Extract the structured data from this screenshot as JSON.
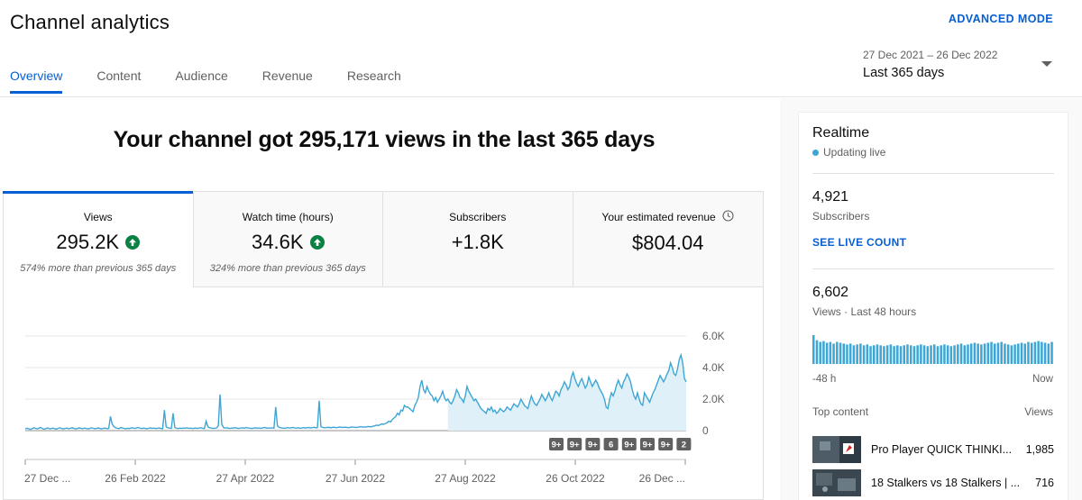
{
  "header": {
    "title": "Channel analytics",
    "advanced_mode": "ADVANCED MODE",
    "tabs": [
      {
        "label": "Overview",
        "active": true
      },
      {
        "label": "Content",
        "active": false
      },
      {
        "label": "Audience",
        "active": false
      },
      {
        "label": "Revenue",
        "active": false
      },
      {
        "label": "Research",
        "active": false
      }
    ],
    "date_range": {
      "dates": "27 Dec 2021 – 26 Dec 2022",
      "label": "Last 365 days"
    }
  },
  "headline": "Your channel got 295,171 views in the last 365 days",
  "metrics": [
    {
      "label": "Views",
      "value": "295.2K",
      "trend": "up",
      "sub": "574% more than previous 365 days"
    },
    {
      "label": "Watch time (hours)",
      "value": "34.6K",
      "trend": "up",
      "sub": "324% more than previous 365 days"
    },
    {
      "label": "Subscribers",
      "value": "+1.8K",
      "trend": "",
      "sub": ""
    },
    {
      "label": "Your estimated revenue",
      "value": "$804.04",
      "trend": "",
      "sub": "",
      "icon": "clock-icon"
    }
  ],
  "chart_data": {
    "type": "area",
    "series": [
      {
        "name": "",
        "values": [
          100,
          150,
          120,
          80,
          130,
          180,
          140,
          110,
          160,
          200,
          120,
          90,
          140,
          170,
          110,
          130,
          160,
          120,
          100,
          150,
          180,
          130,
          110,
          140,
          160,
          120,
          150,
          190,
          140,
          110,
          130,
          170,
          150,
          120,
          160,
          140,
          110,
          130,
          180,
          150,
          120,
          140,
          170,
          130,
          110,
          150,
          160,
          120,
          140,
          900,
          400,
          250,
          180,
          150,
          130,
          200,
          160,
          140,
          120,
          150,
          130,
          180,
          160,
          140,
          170,
          200,
          150,
          130,
          160,
          140,
          120,
          150,
          180,
          140,
          160,
          130,
          150,
          170,
          140,
          120,
          1300,
          250,
          180,
          160,
          140,
          1100,
          200,
          150,
          130,
          160,
          140,
          170,
          150,
          180,
          140,
          160,
          130,
          150,
          170,
          140,
          160,
          180,
          150,
          130,
          600,
          250,
          180,
          160,
          140,
          150,
          170,
          300,
          2300,
          400,
          200,
          160,
          180,
          150,
          140,
          170,
          160,
          190,
          150,
          140,
          160,
          180,
          150,
          200,
          170,
          160,
          140,
          150,
          180,
          160,
          170,
          150,
          160,
          180,
          200,
          150,
          170,
          160,
          180,
          150,
          1500,
          300,
          200,
          180,
          160,
          150,
          170,
          190,
          160,
          180,
          200,
          170,
          160,
          180,
          150,
          170,
          190,
          160,
          180,
          200,
          170,
          190,
          210,
          180,
          200,
          1900,
          250,
          200,
          180,
          190,
          210,
          200,
          180,
          220,
          200,
          190,
          210,
          230,
          200,
          210,
          220,
          200,
          190,
          210,
          230,
          220,
          200,
          210,
          230,
          250,
          220,
          240,
          230,
          260,
          250,
          240,
          280,
          300,
          350,
          320,
          380,
          420,
          400,
          450,
          500,
          600,
          550,
          700,
          800,
          900,
          1100,
          1000,
          1300,
          1250,
          1600,
          1500,
          1500,
          1400,
          1300,
          1200,
          1600,
          1800,
          2100,
          2800,
          3200,
          2600,
          2400,
          2800,
          2500,
          2300,
          2200,
          1900,
          2100,
          1800,
          2000,
          2200,
          2500,
          2100,
          1900,
          2000,
          1800,
          1700,
          1900,
          2200,
          2600,
          2400,
          2100,
          2000,
          1800,
          2200,
          2800,
          2500,
          2300,
          2100,
          1900,
          2000,
          1800,
          1600,
          1400,
          1300,
          1200,
          1100,
          1400,
          1300,
          1500,
          1200,
          1300,
          1100,
          1200,
          1400,
          1300,
          1200,
          1300,
          1500,
          1400,
          1300,
          1500,
          1700,
          1600,
          1500,
          1700,
          2000,
          1800,
          1600,
          1500,
          1400,
          1800,
          2200,
          1900,
          1700,
          1600,
          1800,
          2000,
          2300,
          2100,
          1900,
          2100,
          2400,
          2100,
          1900,
          2200,
          2500,
          2400,
          2200,
          2600,
          2800,
          3100,
          2900,
          2600,
          2800,
          3400,
          3700,
          3300,
          3000,
          2800,
          3100,
          3300,
          3000,
          2700,
          2900,
          3400,
          3100,
          2800,
          3000,
          3200,
          3000,
          2700,
          2500,
          2300,
          2000,
          1500,
          1400,
          2000,
          2400,
          2200,
          2500,
          2900,
          3200,
          2900,
          2700,
          3100,
          3300,
          3600,
          3400,
          3100,
          2600,
          2200,
          2000,
          2400,
          2000,
          1700,
          1600,
          2400,
          2200,
          2000,
          1800,
          2100,
          2400,
          2600,
          2900,
          3200,
          3500,
          3300,
          3100,
          3300,
          3600,
          3800,
          4300,
          4000,
          3600,
          3500,
          3900,
          4500,
          4800,
          4300,
          3300,
          3100
        ]
      }
    ],
    "x_tick_labels": [
      "27 Dec ...",
      "26 Feb 2022",
      "27 Apr 2022",
      "27 Jun 2022",
      "27 Aug 2022",
      "26 Oct 2022",
      "26 Dec ..."
    ],
    "y_tick_labels": [
      "6.0K",
      "4.0K",
      "2.0K",
      "0"
    ],
    "ylim": [
      0,
      6000
    ],
    "grid": true,
    "annotations": [
      "9+",
      "9+",
      "9+",
      "6",
      "9+",
      "9+",
      "9+",
      "2"
    ]
  },
  "realtime": {
    "title": "Realtime",
    "status": "Updating live",
    "subscribers_value": "4,921",
    "subscribers_label": "Subscribers",
    "live_count_link": "SEE LIVE COUNT",
    "views_value": "6,602",
    "views_label": "Views · Last 48 hours",
    "bars": [
      34,
      28,
      26,
      27,
      25,
      26,
      24,
      26,
      25,
      24,
      23,
      24,
      22,
      23,
      24,
      22,
      23,
      21,
      22,
      23,
      22,
      21,
      22,
      23,
      21,
      22,
      21,
      22,
      23,
      22,
      21,
      22,
      23,
      22,
      21,
      22,
      23,
      21,
      22,
      23,
      22,
      21,
      22,
      23,
      24,
      22,
      23,
      24,
      25,
      24,
      23,
      24,
      25,
      26,
      24,
      25,
      26,
      24,
      23,
      22,
      23,
      24,
      25,
      24,
      26,
      25,
      26,
      27,
      26,
      25,
      24,
      26
    ],
    "axis_start": "-48 h",
    "axis_end": "Now",
    "top_content_label": "Top content",
    "views_col_label": "Views",
    "top_content": [
      {
        "title": "Pro Player QUICK THINKI...",
        "views": "1,985"
      },
      {
        "title": "18 Stalkers vs 18 Stalkers | ...",
        "views": "716"
      }
    ]
  }
}
